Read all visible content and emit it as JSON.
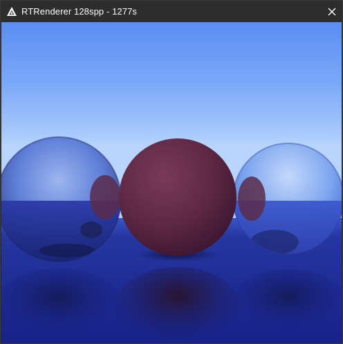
{
  "window": {
    "title": "RTRenderer 128spp - 1277s"
  },
  "icons": {
    "app": "app-logo-icon",
    "close": "close-icon"
  },
  "colors": {
    "sky_top": "#5c8ef2",
    "sky_horizon": "#b6d4fc",
    "floor": "#1c2a8a",
    "sphere_center": "#6a2c4a",
    "titlebar": "#2d2d2d"
  }
}
